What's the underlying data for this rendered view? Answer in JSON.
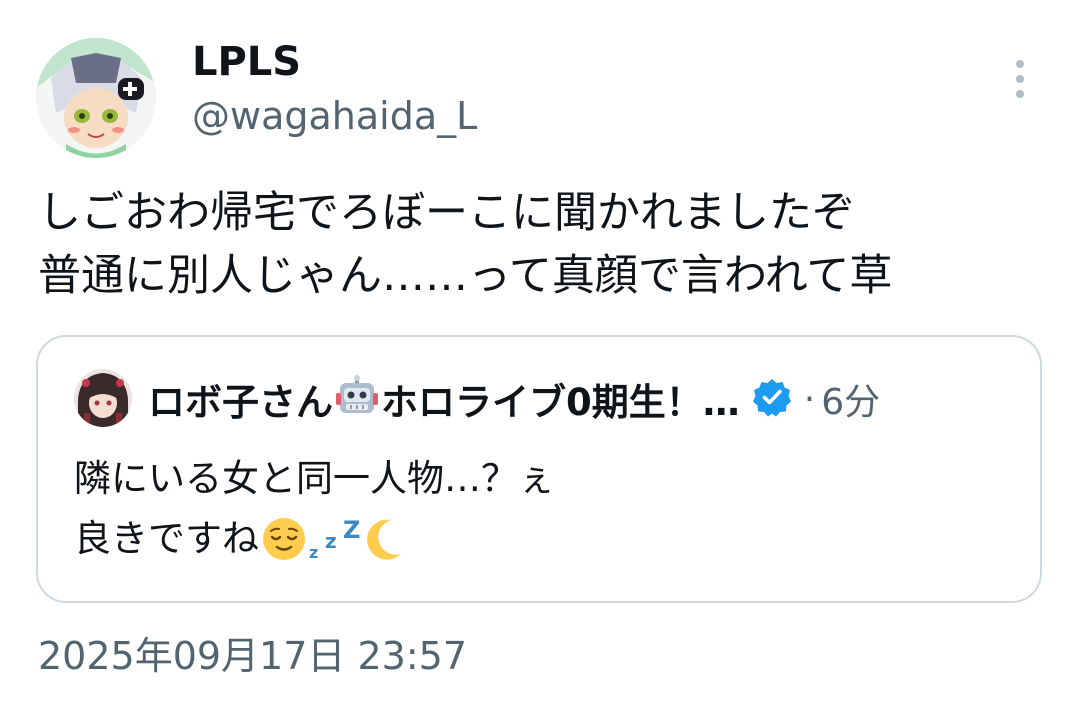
{
  "author": {
    "display_name": "LPLS",
    "handle": "@wagahaida_L",
    "avatar_icon": "profile-avatar"
  },
  "tweet": {
    "lines": [
      "しごおわ帰宅でろぼーこに聞かれましたぞ",
      "普通に別人じゃん……って真顔で言われて草"
    ],
    "timestamp": "2025年09月17日 23:57"
  },
  "quoted_tweet": {
    "name_prefix": "ロボ子さん",
    "name_suffix": "ホロライブ0期生！…",
    "dot": "·",
    "time": "6分",
    "line1": "隣にいる女と同一人物…？ぇ",
    "line2": "良きですね",
    "icons": [
      "robot-emoji",
      "verified-badge-icon",
      "relieved-face-emoji",
      "zzz-emoji",
      "crescent-moon-emoji"
    ]
  },
  "colors": {
    "text": "#0f1419",
    "secondary": "#536471",
    "border": "#cfd9de",
    "verified": "#1d9bf0"
  }
}
